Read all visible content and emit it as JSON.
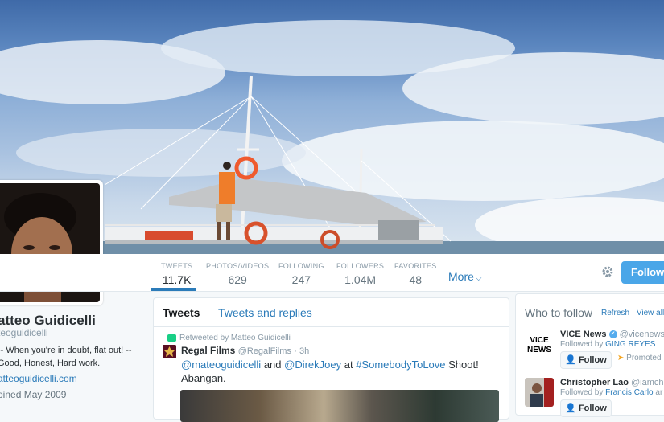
{
  "banner": {},
  "nav": {
    "stats": [
      {
        "label": "TWEETS",
        "value": "11.7K"
      },
      {
        "label": "PHOTOS/VIDEOS",
        "value": "629"
      },
      {
        "label": "FOLLOWING",
        "value": "247"
      },
      {
        "label": "FOLLOWERS",
        "value": "1.04M"
      },
      {
        "label": "FAVORITES",
        "value": "48"
      }
    ],
    "more_label": "More",
    "following_button": "Following"
  },
  "profile": {
    "name": "atteo Guidicelli",
    "handle": "teoguidicelli",
    "bio": "-- When you're in doubt, flat out! -- Good, Honest, Hard work.",
    "link": "atteoguidicelli.com",
    "joined": "oined May 2009"
  },
  "timeline": {
    "tabs": [
      "Tweets",
      "Tweets and replies"
    ],
    "tweet": {
      "retweeted_by": "Retweeted by Matteo Guidicelli",
      "author": "Regal Films",
      "author_handle": "@RegalFilms",
      "time": "· 3h",
      "mention1": "@mateoguidicelli",
      "and": " and ",
      "mention2": "@DirekJoey",
      "at": " at ",
      "hashtag": "#SomebodyToLove",
      "rest": " Shoot! Abangan."
    }
  },
  "who_to_follow": {
    "title": "Who to follow",
    "refresh": "Refresh",
    "sep": " · ",
    "view_all": "View all",
    "suggestions": [
      {
        "name": "VICE News",
        "handle": "@vicenews",
        "followed_prefix": "Followed by ",
        "followed_by": "GING REYES",
        "follow_label": "Follow",
        "promoted": "Promoted",
        "thumb_text": "VICE NEWS"
      },
      {
        "name": "Christopher Lao",
        "handle": "@iamchrisla",
        "followed_prefix": "Followed by ",
        "followed_by": "Francis Carlo",
        "followed_suffix": " ar",
        "follow_label": "Follow"
      }
    ]
  },
  "colors": {
    "accent": "#2b7bb9",
    "following_button": "#4aa6e8",
    "retweet_green": "#19cf86"
  }
}
